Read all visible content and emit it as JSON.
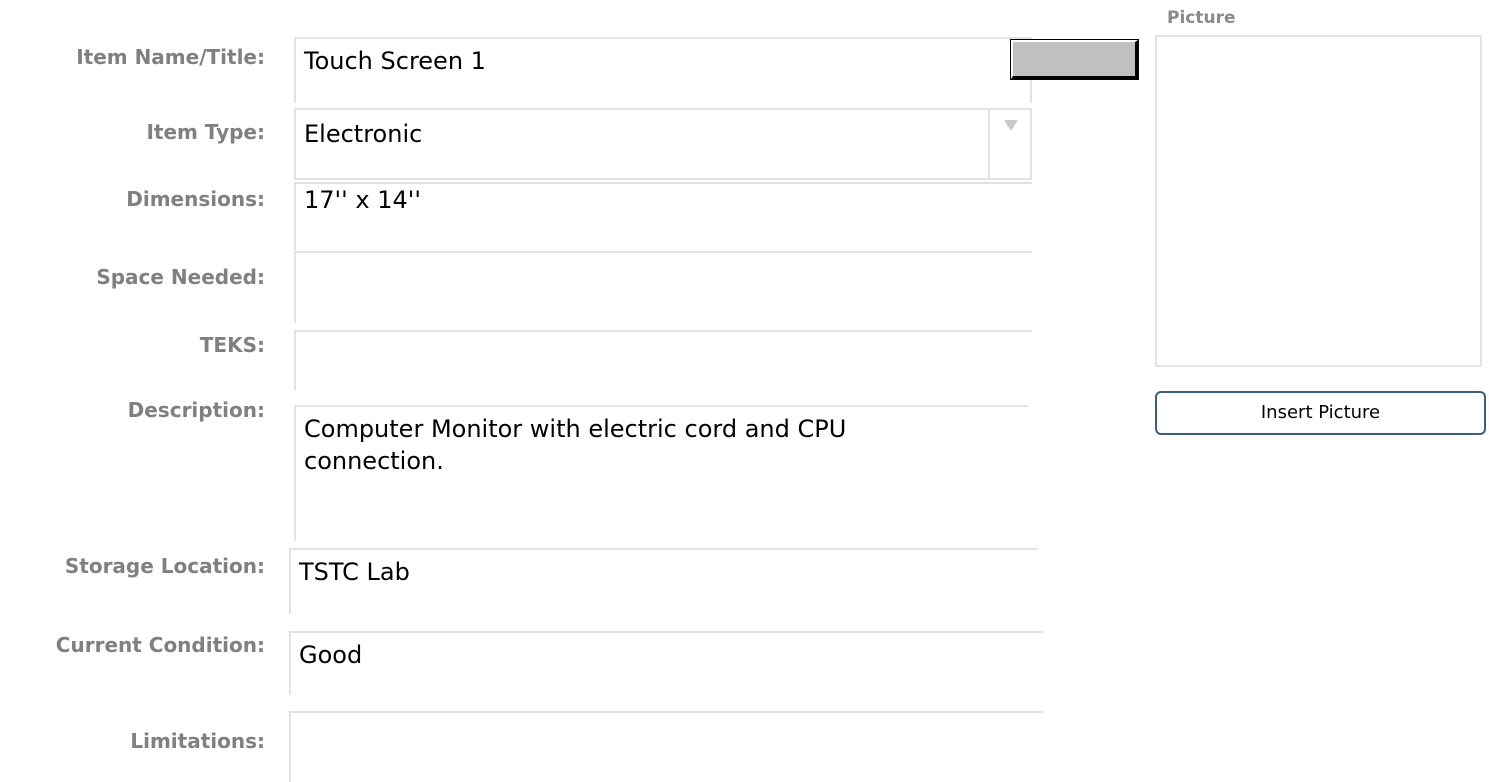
{
  "form": {
    "item_name": {
      "label": "Item Name/Title:",
      "value": "Touch Screen 1"
    },
    "item_type": {
      "label": "Item Type:",
      "value": "Electronic"
    },
    "dimensions": {
      "label": "Dimensions:",
      "value": "17'' x 14''"
    },
    "space_needed": {
      "label": "Space Needed:",
      "value": ""
    },
    "teks": {
      "label": "TEKS:",
      "value": ""
    },
    "description": {
      "label": "Description:",
      "value": "Computer Monitor with electric cord and CPU connection."
    },
    "storage_location": {
      "label": "Storage Location:",
      "value": "TSTC Lab"
    },
    "current_condition": {
      "label": "Current Condition:",
      "value": "Good"
    },
    "limitations": {
      "label": "Limitations:",
      "value": ""
    }
  },
  "picture": {
    "label": "Picture",
    "insert_label": "Insert Picture"
  },
  "colors": {
    "label_gray": "#808080",
    "field_border": "#e3e3e3",
    "button_gray": "#c0c0c0",
    "insert_border": "#3d5f7f"
  }
}
